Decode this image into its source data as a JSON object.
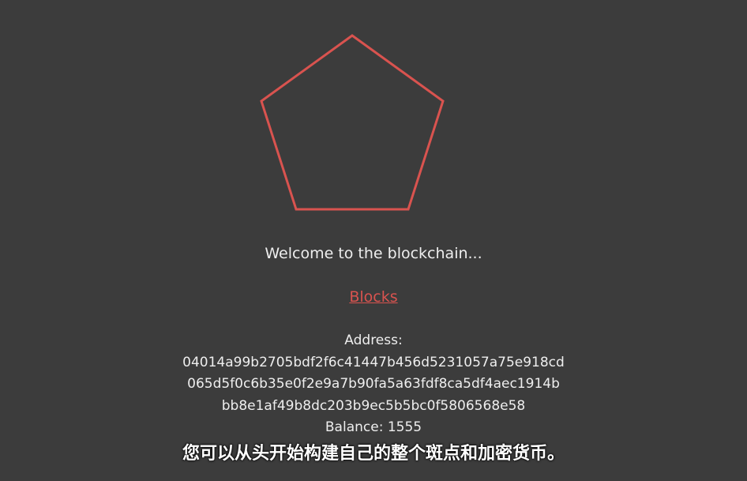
{
  "app": {
    "accent_color": "#d9534f",
    "background_color": "#3c3c3c",
    "logo_icon": "pentagon-icon"
  },
  "welcome_text": "Welcome to the blockchain...",
  "nav": {
    "blocks_label": "Blocks"
  },
  "wallet": {
    "address_label": "Address:",
    "address_lines": [
      "04014a99b2705bdf2f6c41447b456d5231057a75e918cd",
      "065d5f0c6b35e0f2e9a7b90fa5a63fdf8ca5df4aec1914b",
      "bb8e1af49b8dc203b9ec5b5bc0f5806568e58"
    ],
    "balance_text": "Balance: 1555"
  },
  "subtitle": "您可以从头开始构建自己的整个斑点和加密货币。"
}
